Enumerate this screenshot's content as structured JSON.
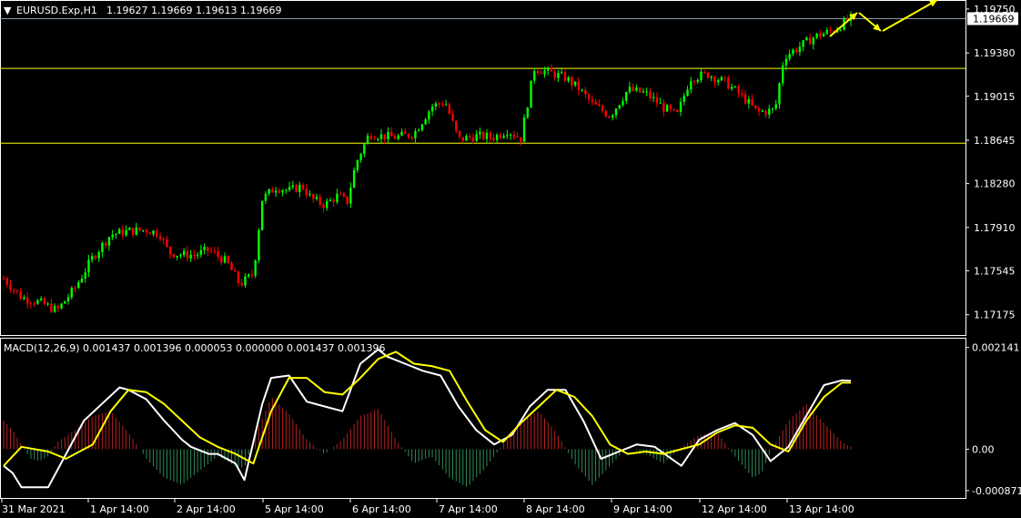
{
  "header": {
    "symbol_label": "EURUSD.Exp,H1",
    "ohlc_label": "1.19627 1.19669 1.19613 1.19669",
    "menu_icon": "triangle-down-icon"
  },
  "indicator": {
    "label": "MACD(12,26,9) 0.001437 0.001396 0.000053 0.000000 0.001437 0.001396"
  },
  "colors": {
    "background": "#000000",
    "grid_border": "#ffffff",
    "bull_candle": "#00ff00",
    "bear_candle": "#ff0000",
    "level_line": "#ffff00",
    "arrow": "#ffff00",
    "macd_line": "#ffffff",
    "signal_line": "#ffff00",
    "hist_positive": "#b22222",
    "hist_negative": "#2e8b57",
    "current_price_tag": "#ffffff"
  },
  "chart_data": [
    {
      "type": "candlestick",
      "title": "EURUSD.Exp,H1",
      "y_ticks": [
        "1.19750",
        "1.19380",
        "1.19015",
        "1.18645",
        "1.18280",
        "1.17910",
        "1.17545",
        "1.17175"
      ],
      "ylim": [
        1.1705,
        1.1978
      ],
      "current_price": "1.19669",
      "horizontal_levels": [
        1.1925,
        1.1862
      ],
      "trend_path": [
        {
          "x": 0.0,
          "y": 1.1748
        },
        {
          "x": 2.0,
          "y": 1.1732
        },
        {
          "x": 4.0,
          "y": 1.1728
        },
        {
          "x": 6.0,
          "y": 1.1721
        },
        {
          "x": 8.0,
          "y": 1.174
        },
        {
          "x": 10.0,
          "y": 1.1766
        },
        {
          "x": 12.0,
          "y": 1.1785
        },
        {
          "x": 14.0,
          "y": 1.1788
        },
        {
          "x": 16.0,
          "y": 1.1789
        },
        {
          "x": 17.5,
          "y": 1.1786
        },
        {
          "x": 18.5,
          "y": 1.177
        },
        {
          "x": 20.0,
          "y": 1.1768
        },
        {
          "x": 21.5,
          "y": 1.1768
        },
        {
          "x": 23.0,
          "y": 1.1772
        },
        {
          "x": 25.0,
          "y": 1.1762
        },
        {
          "x": 26.5,
          "y": 1.1743
        },
        {
          "x": 28.0,
          "y": 1.1752
        },
        {
          "x": 29.0,
          "y": 1.1815
        },
        {
          "x": 30.5,
          "y": 1.1825
        },
        {
          "x": 32.0,
          "y": 1.1822
        },
        {
          "x": 33.5,
          "y": 1.1826
        },
        {
          "x": 34.5,
          "y": 1.1815
        },
        {
          "x": 36.0,
          "y": 1.181
        },
        {
          "x": 37.5,
          "y": 1.1818
        },
        {
          "x": 38.5,
          "y": 1.1812
        },
        {
          "x": 39.5,
          "y": 1.1845
        },
        {
          "x": 41.0,
          "y": 1.187
        },
        {
          "x": 42.5,
          "y": 1.1868
        },
        {
          "x": 44.0,
          "y": 1.1867
        },
        {
          "x": 46.0,
          "y": 1.187
        },
        {
          "x": 48.0,
          "y": 1.1893
        },
        {
          "x": 49.5,
          "y": 1.1897
        },
        {
          "x": 51.0,
          "y": 1.1865
        },
        {
          "x": 53.0,
          "y": 1.1868
        },
        {
          "x": 55.0,
          "y": 1.1867
        },
        {
          "x": 56.5,
          "y": 1.1873
        },
        {
          "x": 58.0,
          "y": 1.1866
        },
        {
          "x": 59.5,
          "y": 1.1925
        },
        {
          "x": 61.0,
          "y": 1.1922
        },
        {
          "x": 63.0,
          "y": 1.1917
        },
        {
          "x": 64.5,
          "y": 1.1908
        },
        {
          "x": 66.0,
          "y": 1.1895
        },
        {
          "x": 68.0,
          "y": 1.1885
        },
        {
          "x": 70.0,
          "y": 1.1907
        },
        {
          "x": 72.0,
          "y": 1.1904
        },
        {
          "x": 74.0,
          "y": 1.1892
        },
        {
          "x": 75.5,
          "y": 1.1885
        },
        {
          "x": 77.0,
          "y": 1.1917
        },
        {
          "x": 79.0,
          "y": 1.192
        },
        {
          "x": 81.0,
          "y": 1.1913
        },
        {
          "x": 83.0,
          "y": 1.19
        },
        {
          "x": 84.5,
          "y": 1.1888
        },
        {
          "x": 86.5,
          "y": 1.189
        },
        {
          "x": 87.5,
          "y": 1.1935
        },
        {
          "x": 89.0,
          "y": 1.1942
        },
        {
          "x": 91.0,
          "y": 1.1952
        },
        {
          "x": 93.0,
          "y": 1.1957
        },
        {
          "x": 95.0,
          "y": 1.1967
        }
      ]
    },
    {
      "type": "line",
      "title": "MACD(12,26,9)",
      "y_ticks": [
        "0.002141",
        "0.00",
        "-0.000871"
      ],
      "ylim": [
        -0.00095,
        0.00225
      ],
      "x_ticks": [
        "31 Mar 2021",
        "1 Apr 14:00",
        "2 Apr 14:00",
        "5 Apr 14:00",
        "6 Apr 14:00",
        "7 Apr 14:00",
        "8 Apr 14:00",
        "9 Apr 14:00",
        "12 Apr 14:00",
        "13 Apr 14:00"
      ],
      "series": [
        {
          "values": [
            {
              "x": 0,
              "y": -0.00035
            },
            {
              "x": 1,
              "y": -0.0005
            },
            {
              "x": 2,
              "y": -0.0008
            },
            {
              "x": 5,
              "y": -0.0008
            },
            {
              "x": 6,
              "y": -0.00045
            },
            {
              "x": 9,
              "y": 0.0006
            },
            {
              "x": 11,
              "y": 0.00095
            },
            {
              "x": 13,
              "y": 0.0013
            },
            {
              "x": 14,
              "y": 0.00125
            },
            {
              "x": 16,
              "y": 0.00105
            },
            {
              "x": 18,
              "y": 0.0006
            },
            {
              "x": 20,
              "y": 0.0002
            },
            {
              "x": 21,
              "y": 5e-05
            },
            {
              "x": 23,
              "y": -0.0001
            },
            {
              "x": 24,
              "y": -0.0001
            },
            {
              "x": 26,
              "y": -0.0003
            },
            {
              "x": 27,
              "y": -0.00065
            },
            {
              "x": 29,
              "y": 0.00095
            },
            {
              "x": 30,
              "y": 0.0015
            },
            {
              "x": 32,
              "y": 0.00155
            },
            {
              "x": 34,
              "y": 0.001
            },
            {
              "x": 36,
              "y": 0.0009
            },
            {
              "x": 38,
              "y": 0.0008
            },
            {
              "x": 40,
              "y": 0.0018
            },
            {
              "x": 42,
              "y": 0.0021
            },
            {
              "x": 43,
              "y": 0.00195
            },
            {
              "x": 45,
              "y": 0.0018
            },
            {
              "x": 47,
              "y": 0.00165
            },
            {
              "x": 49,
              "y": 0.00155
            },
            {
              "x": 51,
              "y": 0.0009
            },
            {
              "x": 53,
              "y": 0.0004
            },
            {
              "x": 55,
              "y": 0.0001
            },
            {
              "x": 57,
              "y": 0.0003
            },
            {
              "x": 59,
              "y": 0.0009
            },
            {
              "x": 61,
              "y": 0.00125
            },
            {
              "x": 63,
              "y": 0.00125
            },
            {
              "x": 65,
              "y": 0.0006
            },
            {
              "x": 67,
              "y": -0.0002
            },
            {
              "x": 69,
              "y": -5e-05
            },
            {
              "x": 71,
              "y": 0.0001
            },
            {
              "x": 73,
              "y": 5e-05
            },
            {
              "x": 76,
              "y": -0.00035
            },
            {
              "x": 78,
              "y": 0.0002
            },
            {
              "x": 80,
              "y": 0.0004
            },
            {
              "x": 82,
              "y": 0.00055
            },
            {
              "x": 84,
              "y": 0.0003
            },
            {
              "x": 86,
              "y": -0.00025
            },
            {
              "x": 88,
              "y": 5e-05
            },
            {
              "x": 90,
              "y": 0.0007
            },
            {
              "x": 92,
              "y": 0.00135
            },
            {
              "x": 94,
              "y": 0.00145
            },
            {
              "x": 95,
              "y": 0.00144
            }
          ]
        },
        {
          "values": [
            {
              "x": 0,
              "y": -0.00035
            },
            {
              "x": 2,
              "y": 5e-05
            },
            {
              "x": 5,
              "y": -5e-05
            },
            {
              "x": 7,
              "y": -0.0002
            },
            {
              "x": 10,
              "y": 0.0001
            },
            {
              "x": 12,
              "y": 0.0008
            },
            {
              "x": 14,
              "y": 0.00125
            },
            {
              "x": 16,
              "y": 0.0012
            },
            {
              "x": 18,
              "y": 0.00095
            },
            {
              "x": 20,
              "y": 0.0006
            },
            {
              "x": 22,
              "y": 0.00025
            },
            {
              "x": 24,
              "y": 5e-05
            },
            {
              "x": 26,
              "y": -0.0001
            },
            {
              "x": 28,
              "y": -0.0003
            },
            {
              "x": 30,
              "y": 0.0008
            },
            {
              "x": 32,
              "y": 0.0015
            },
            {
              "x": 34,
              "y": 0.0015
            },
            {
              "x": 36,
              "y": 0.0012
            },
            {
              "x": 38,
              "y": 0.00115
            },
            {
              "x": 40,
              "y": 0.0015
            },
            {
              "x": 42,
              "y": 0.0019
            },
            {
              "x": 44,
              "y": 0.00205
            },
            {
              "x": 46,
              "y": 0.0018
            },
            {
              "x": 48,
              "y": 0.00175
            },
            {
              "x": 50,
              "y": 0.00165
            },
            {
              "x": 52,
              "y": 0.001
            },
            {
              "x": 54,
              "y": 0.0004
            },
            {
              "x": 56,
              "y": 0.00015
            },
            {
              "x": 58,
              "y": 0.00055
            },
            {
              "x": 60,
              "y": 0.0009
            },
            {
              "x": 62,
              "y": 0.00125
            },
            {
              "x": 64,
              "y": 0.0011
            },
            {
              "x": 66,
              "y": 0.0007
            },
            {
              "x": 68,
              "y": 0.0001
            },
            {
              "x": 70,
              "y": -0.0001
            },
            {
              "x": 72,
              "y": -5e-05
            },
            {
              "x": 74,
              "y": -0.0001
            },
            {
              "x": 76,
              "y": 0.0
            },
            {
              "x": 78,
              "y": 0.0001
            },
            {
              "x": 80,
              "y": 0.00035
            },
            {
              "x": 82,
              "y": 0.0005
            },
            {
              "x": 84,
              "y": 0.00045
            },
            {
              "x": 86,
              "y": 0.0001
            },
            {
              "x": 88,
              "y": -5e-05
            },
            {
              "x": 90,
              "y": 0.0006
            },
            {
              "x": 92,
              "y": 0.0011
            },
            {
              "x": 94,
              "y": 0.0014
            },
            {
              "x": 95,
              "y": 0.0014
            }
          ]
        }
      ],
      "histogram": [
        {
          "x": 0,
          "y": 0.0006
        },
        {
          "x": 1,
          "y": 0.0004
        },
        {
          "x": 2,
          "y": 0.0001
        },
        {
          "x": 3,
          "y": -0.0002
        },
        {
          "x": 4,
          "y": -0.00025
        },
        {
          "x": 5,
          "y": -0.00015
        },
        {
          "x": 6,
          "y": 0.00015
        },
        {
          "x": 8,
          "y": 0.0004
        },
        {
          "x": 10,
          "y": 0.0007
        },
        {
          "x": 12,
          "y": 0.0008
        },
        {
          "x": 14,
          "y": 0.00035
        },
        {
          "x": 16,
          "y": -0.0002
        },
        {
          "x": 18,
          "y": -0.0006
        },
        {
          "x": 20,
          "y": -0.00075
        },
        {
          "x": 22,
          "y": -0.00045
        },
        {
          "x": 24,
          "y": -0.00015
        },
        {
          "x": 26,
          "y": -0.00035
        },
        {
          "x": 27,
          "y": -0.0004
        },
        {
          "x": 28,
          "y": 0.0002
        },
        {
          "x": 30,
          "y": 0.0011
        },
        {
          "x": 32,
          "y": 0.00075
        },
        {
          "x": 34,
          "y": 0.0002
        },
        {
          "x": 36,
          "y": -0.0001
        },
        {
          "x": 38,
          "y": 0.0002
        },
        {
          "x": 40,
          "y": 0.0007
        },
        {
          "x": 42,
          "y": 0.00085
        },
        {
          "x": 44,
          "y": 0.0002
        },
        {
          "x": 46,
          "y": -0.0003
        },
        {
          "x": 48,
          "y": -0.00015
        },
        {
          "x": 50,
          "y": -0.0006
        },
        {
          "x": 52,
          "y": -0.0008
        },
        {
          "x": 54,
          "y": -0.0004
        },
        {
          "x": 56,
          "y": 0.0001
        },
        {
          "x": 58,
          "y": 0.0006
        },
        {
          "x": 60,
          "y": 0.0008
        },
        {
          "x": 62,
          "y": 0.00035
        },
        {
          "x": 64,
          "y": -0.0003
        },
        {
          "x": 66,
          "y": -0.00075
        },
        {
          "x": 68,
          "y": -0.00035
        },
        {
          "x": 70,
          "y": 5e-05
        },
        {
          "x": 72,
          "y": -0.0001
        },
        {
          "x": 74,
          "y": -0.0003
        },
        {
          "x": 76,
          "y": 5e-05
        },
        {
          "x": 78,
          "y": 0.0003
        },
        {
          "x": 80,
          "y": 0.00035
        },
        {
          "x": 82,
          "y": -0.00015
        },
        {
          "x": 84,
          "y": -0.0006
        },
        {
          "x": 85,
          "y": -0.0005
        },
        {
          "x": 86,
          "y": -5e-05
        },
        {
          "x": 88,
          "y": 0.0006
        },
        {
          "x": 90,
          "y": 0.00095
        },
        {
          "x": 92,
          "y": 0.00055
        },
        {
          "x": 94,
          "y": 0.00015
        },
        {
          "x": 95,
          "y": 5e-05
        }
      ]
    }
  ]
}
